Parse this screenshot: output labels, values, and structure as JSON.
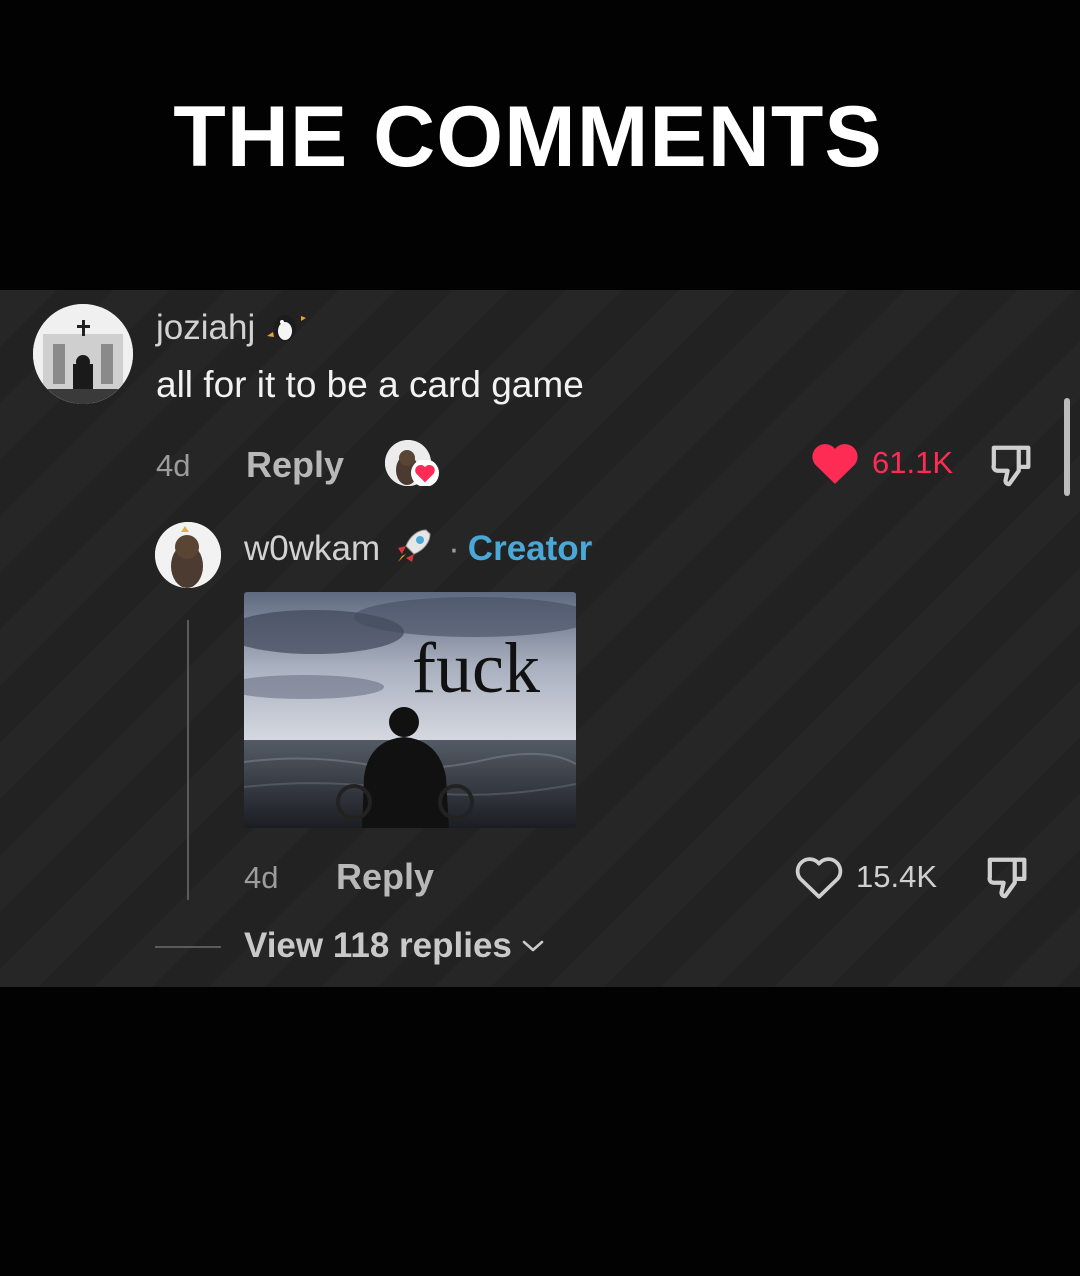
{
  "headline": "THE COMMENTS",
  "comment": {
    "username": "joziahj",
    "username_emoji": "penguin-icon",
    "text": "all for it to be a card game",
    "age": "4d",
    "reply_label": "Reply",
    "likes": "61.1K",
    "liked": true,
    "liked_by_creator": true
  },
  "reply": {
    "username": "w0wkam",
    "username_emoji": "rocket-icon",
    "separator": "·",
    "badge": "Creator",
    "image_caption": "fuck",
    "age": "4d",
    "reply_label": "Reply",
    "likes": "15.4K",
    "liked": false
  },
  "view_replies": "View 118 replies",
  "colors": {
    "like_red": "#fe2c55",
    "creator_blue": "#4aa8d8",
    "panel_bg": "#232323"
  }
}
